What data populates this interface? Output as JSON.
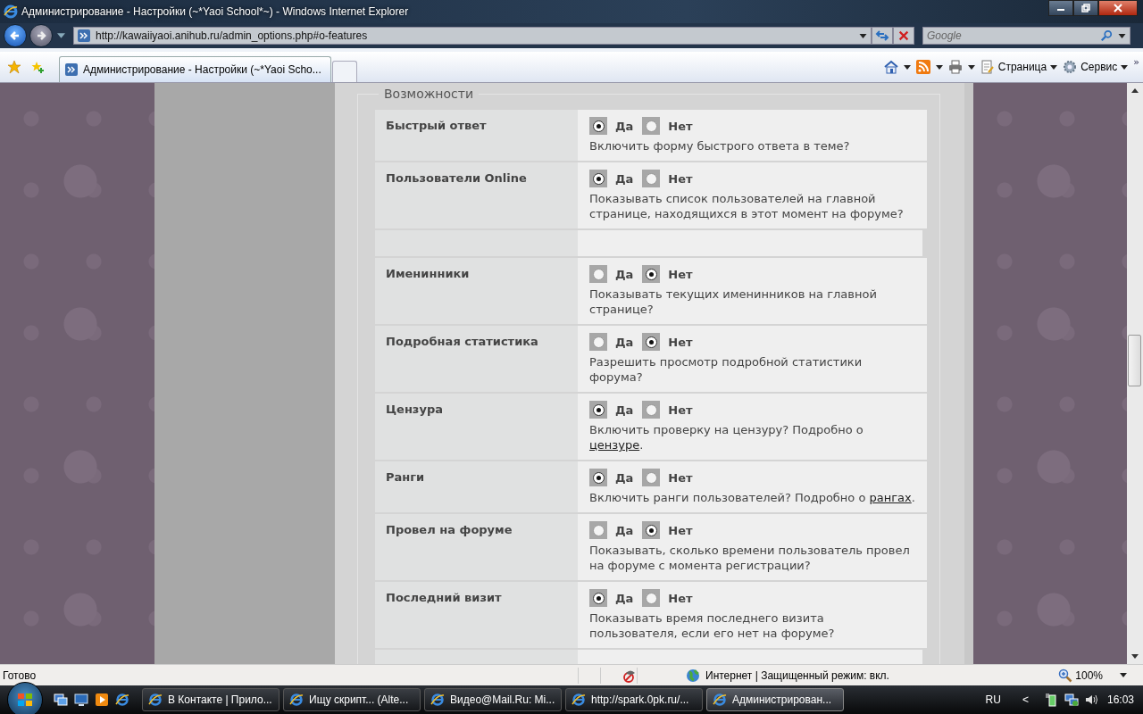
{
  "window": {
    "title": "Администрирование - Настройки (~*Yaoi School*~) - Windows Internet Explorer"
  },
  "address_bar": {
    "url": "http://kawaiiyaoi.anihub.ru/admin_options.php#o-features"
  },
  "search": {
    "placeholder": "Google"
  },
  "tabs": [
    {
      "label": "Администрирование - Настройки (~*Yaoi Scho...",
      "selected": true
    }
  ],
  "command_bar": {
    "page_menu": "Страница",
    "tools_menu": "Сервис",
    "more": "»"
  },
  "section": {
    "legend": "Возможности",
    "rows": [
      {
        "kind": "option",
        "label": "Быстрый ответ",
        "options": [
          {
            "label": "Да",
            "selected": true
          },
          {
            "label": "Нет",
            "selected": false
          }
        ],
        "description": [
          {
            "kind": "text",
            "text": "Включить форму быстрого ответа в теме?"
          }
        ]
      },
      {
        "kind": "option",
        "label": "Пользователи Online",
        "options": [
          {
            "label": "Да",
            "selected": true
          },
          {
            "label": "Нет",
            "selected": false
          }
        ],
        "description": [
          {
            "kind": "text",
            "text": "Показывать список пользователей на главной странице, находящихся в этот момент на форуме?"
          }
        ]
      },
      {
        "kind": "empty"
      },
      {
        "kind": "option",
        "label": "Именинники",
        "options": [
          {
            "label": "Да",
            "selected": false
          },
          {
            "label": "Нет",
            "selected": true
          }
        ],
        "description": [
          {
            "kind": "text",
            "text": "Показывать текущих именинников на главной странице?"
          }
        ]
      },
      {
        "kind": "option",
        "label": "Подробная статистика",
        "options": [
          {
            "label": "Да",
            "selected": false
          },
          {
            "label": "Нет",
            "selected": true
          }
        ],
        "description": [
          {
            "kind": "text",
            "text": "Разрешить просмотр подробной статистики форума?"
          }
        ]
      },
      {
        "kind": "option",
        "label": "Цензура",
        "options": [
          {
            "label": "Да",
            "selected": true
          },
          {
            "label": "Нет",
            "selected": false
          }
        ],
        "description": [
          {
            "kind": "text",
            "text": "Включить проверку на цензуру? Подробно о "
          },
          {
            "kind": "link",
            "text": "цензуре"
          },
          {
            "kind": "text",
            "text": "."
          }
        ]
      },
      {
        "kind": "option",
        "label": "Ранги",
        "options": [
          {
            "label": "Да",
            "selected": true
          },
          {
            "label": "Нет",
            "selected": false
          }
        ],
        "description": [
          {
            "kind": "text",
            "text": "Включить ранги пользователей? Подробно о "
          },
          {
            "kind": "link",
            "text": "рангах"
          },
          {
            "kind": "text",
            "text": "."
          }
        ]
      },
      {
        "kind": "option",
        "label": "Провел на форуме",
        "options": [
          {
            "label": "Да",
            "selected": false
          },
          {
            "label": "Нет",
            "selected": true
          }
        ],
        "description": [
          {
            "kind": "text",
            "text": "Показывать, сколько времени пользователь провел на форуме с момента регистрации?"
          }
        ]
      },
      {
        "kind": "option",
        "label": "Последний визит",
        "options": [
          {
            "label": "Да",
            "selected": true
          },
          {
            "label": "Нет",
            "selected": false
          }
        ],
        "description": [
          {
            "kind": "text",
            "text": "Показывать время последнего визита пользователя, если его нет на форуме?"
          }
        ]
      },
      {
        "kind": "empty"
      }
    ]
  },
  "status_bar": {
    "status": "Готово",
    "zone": "Интернет | Защищенный режим: вкл.",
    "zoom": "100%"
  },
  "taskbar": {
    "buttons": [
      {
        "label": "В Контакте | Прило...",
        "selected": false
      },
      {
        "label": "Ищу скрипт... (Alte...",
        "selected": false
      },
      {
        "label": "Видео@Mail.Ru: Mi...",
        "selected": false
      },
      {
        "label": "http://spark.0pk.ru/...",
        "selected": false
      },
      {
        "label": "Администрирован...",
        "selected": true
      }
    ],
    "language": "RU",
    "expand": "<",
    "clock": "16:03"
  }
}
